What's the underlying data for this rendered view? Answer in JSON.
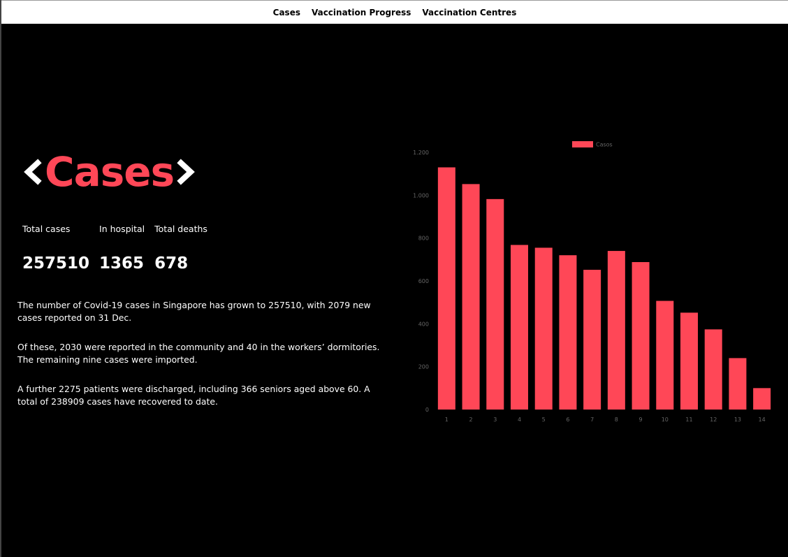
{
  "nav": {
    "items": [
      "Cases",
      "Vaccination Progress",
      "Vaccination Centres"
    ]
  },
  "hero": {
    "title": "Cases"
  },
  "stats": [
    {
      "label": "Total cases",
      "value": "257510"
    },
    {
      "label": "In hospital",
      "value": "1365"
    },
    {
      "label": "Total deaths",
      "value": "678"
    }
  ],
  "paragraphs": [
    "The number of Covid-19 cases in Singapore has grown to 257510, with 2079 new cases reported on 31 Dec.",
    "Of these, 2030 were reported in the community and 40 in the workers’ dormitories. The remaining nine cases were imported.",
    "A further 2275 patients were discharged, including 366 seniors aged above 60. A total of 238909 cases have recovered to date."
  ],
  "colors": {
    "accent": "#ff4757",
    "background": "#000000",
    "nav_bg": "#ffffff"
  },
  "chart_data": {
    "type": "bar",
    "categories": [
      "1",
      "2",
      "3",
      "4",
      "5",
      "6",
      "7",
      "8",
      "9",
      "10",
      "11",
      "12",
      "13",
      "14"
    ],
    "series": [
      {
        "name": "Casos",
        "values": [
          1130,
          1052,
          982,
          768,
          755,
          720,
          652,
          740,
          688,
          507,
          452,
          374,
          240,
          100
        ]
      }
    ],
    "ylim": [
      0,
      1200
    ],
    "yticks": [
      "0",
      "200",
      "400",
      "600",
      "800",
      "1.000",
      "1.200"
    ],
    "legend": "top-center",
    "grid": false
  }
}
